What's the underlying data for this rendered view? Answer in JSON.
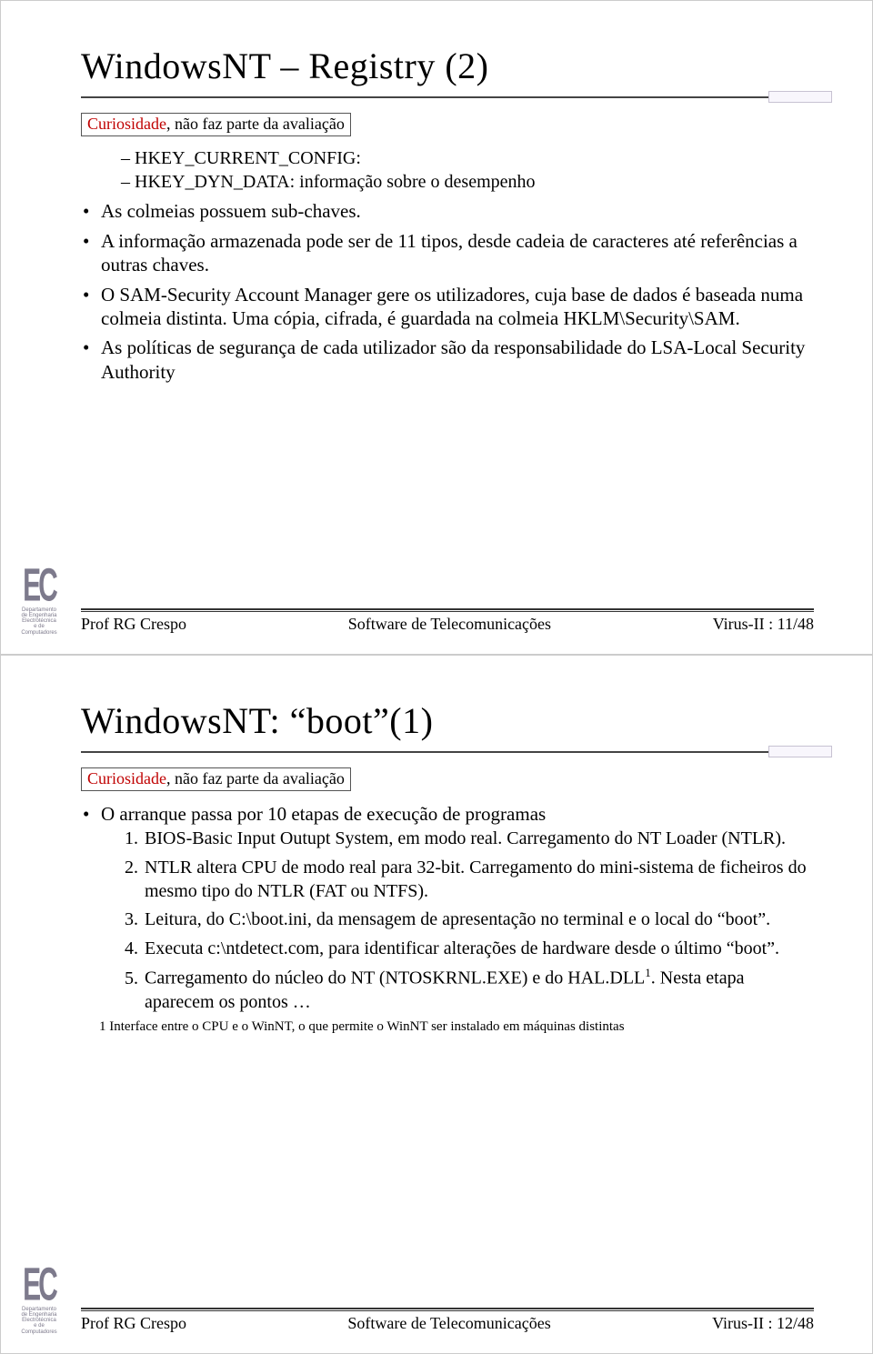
{
  "slide1": {
    "title": "WindowsNT – Registry (2)",
    "note_red": "Curiosidade",
    "note_rest": ", não faz parte da avaliação",
    "dashes": [
      "HKEY_CURRENT_CONFIG:",
      "HKEY_DYN_DATA: informação sobre o desempenho"
    ],
    "bullets": [
      "As colmeias possuem sub-chaves.",
      "A informação armazenada pode ser de 11 tipos, desde cadeia de caracteres até referências a outras chaves.",
      "O SAM-Security Account Manager gere os utilizadores, cuja base de dados é baseada numa colmeia distinta. Uma cópia, cifrada, é guardada na colmeia HKLM\\Security\\SAM.",
      "As políticas de segurança de cada utilizador são da responsabilidade do LSA-Local Security Authority"
    ],
    "footer_left": "Prof RG Crespo",
    "footer_center": "Software de Telecomunicações",
    "footer_right": "Virus-II : 11/48"
  },
  "slide2": {
    "title": "WindowsNT: “boot”(1)",
    "note_red": "Curiosidade",
    "note_rest": ", não faz parte da avaliação",
    "bullet_intro": "O arranque passa por 10 etapas de execução de programas",
    "numbered": [
      "BIOS-Basic Input Outupt System, em modo real. Carregamento do NT Loader (NTLR).",
      "NTLR altera CPU de modo real para 32-bit. Carregamento do mini-sistema de ficheiros  do mesmo tipo do NTLR (FAT ou NTFS).",
      "Leitura, do C:\\boot.ini, da mensagem de apresentação no terminal e o local do “boot”.",
      "Executa c:\\ntdetect.com, para identificar alterações de hardware desde o último “boot”.",
      {
        "pre": "Carregamento do núcleo do NT (NTOSKRNL.EXE) e do HAL.DLL",
        "sup": "1",
        "post": ". Nesta etapa aparecem os pontos …"
      }
    ],
    "footnote": "1 Interface entre o CPU e o WinNT, o que permite o WinNT ser instalado em máquinas distintas",
    "footer_left": "Prof RG Crespo",
    "footer_center": "Software de Telecomunicações",
    "footer_right": "Virus-II : 12/48"
  },
  "logo": {
    "big": "EC",
    "lines": [
      "Departamento",
      "de Engenharia",
      "Electrotécnica",
      "e de",
      "Computadores"
    ]
  }
}
